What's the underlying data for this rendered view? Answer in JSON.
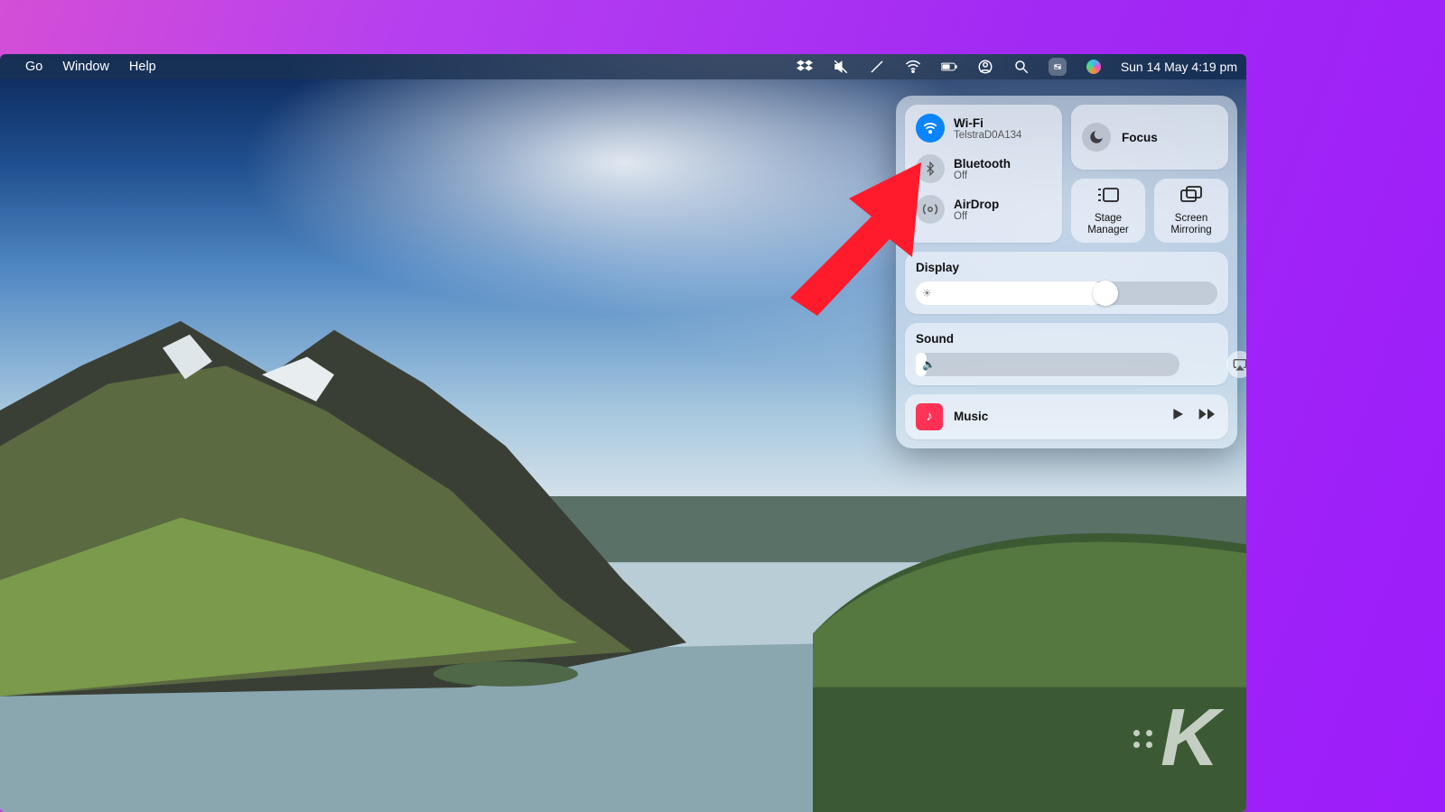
{
  "menubar": {
    "items": [
      "Go",
      "Window",
      "Help"
    ],
    "datetime": "Sun 14 May  4:19 pm"
  },
  "control_center": {
    "wifi": {
      "title": "Wi-Fi",
      "sub": "TelstraD0A134"
    },
    "bluetooth": {
      "title": "Bluetooth",
      "sub": "Off"
    },
    "airdrop": {
      "title": "AirDrop",
      "sub": "Off"
    },
    "focus": {
      "title": "Focus"
    },
    "stage": {
      "title": "Stage Manager"
    },
    "mirror": {
      "title": "Screen Mirroring"
    },
    "display": {
      "label": "Display",
      "value_pct": 63
    },
    "sound": {
      "label": "Sound",
      "value_pct": 0
    },
    "music": {
      "label": "Music"
    }
  },
  "watermark": "K"
}
